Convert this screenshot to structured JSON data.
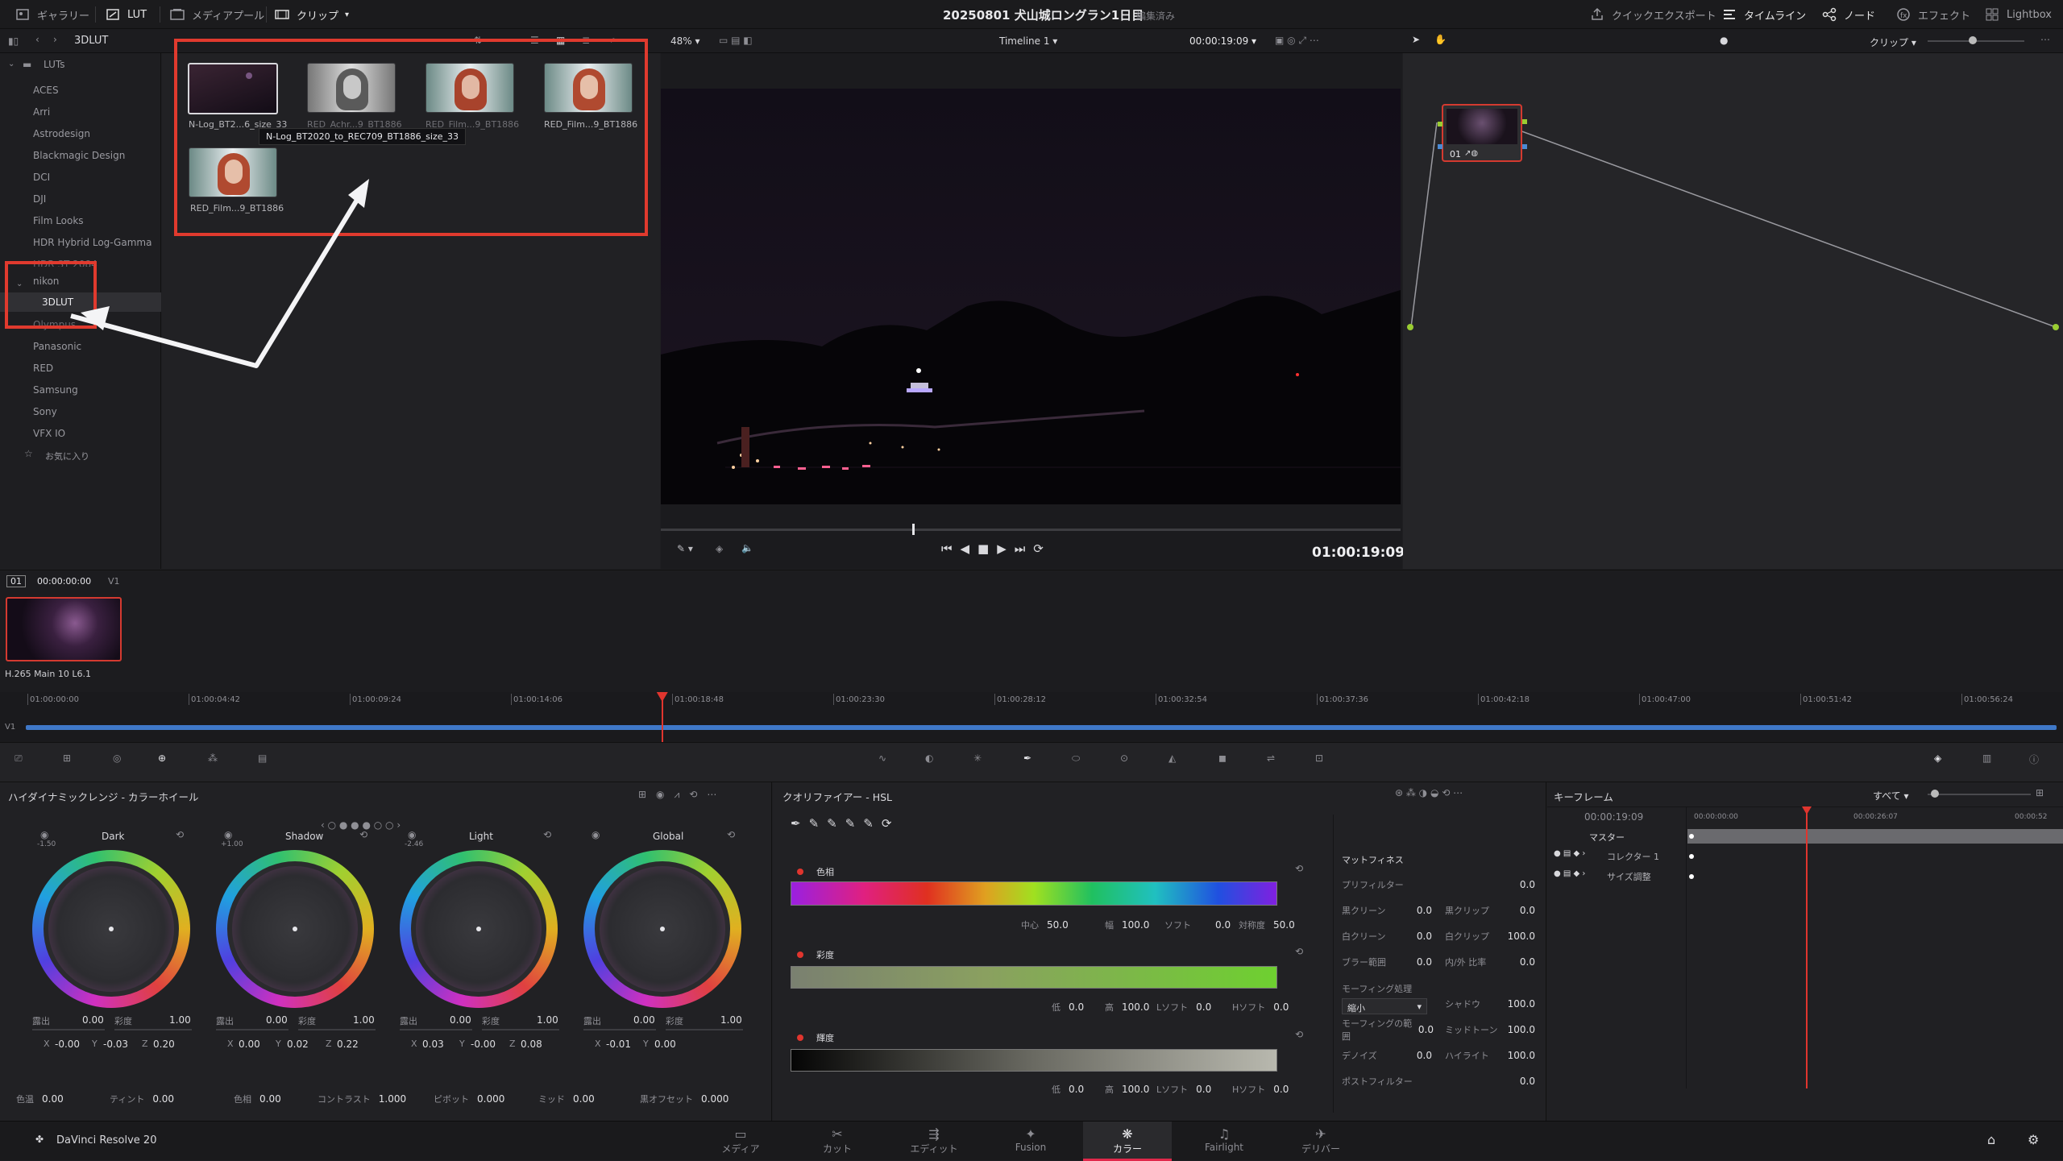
{
  "topbar": {
    "gallery": "ギャラリー",
    "lut": "LUT",
    "media_pool": "メディアプール",
    "clip": "クリップ",
    "project_title": "20250801 犬山城ロングラン1日目",
    "project_status": "編集済み",
    "quick_export": "クイックエクスポート",
    "timeline": "タイムライン",
    "nodes": "ノード",
    "effects": "エフェクト",
    "lightbox": "Lightbox"
  },
  "subbar": {
    "folder": "3DLUT",
    "zoom": "48%",
    "timeline_name": "Timeline 1",
    "timecode": "00:00:19:09",
    "clip_mode": "クリップ"
  },
  "lut_tree": {
    "root": "LUTs",
    "items": [
      "ACES",
      "Arri",
      "Astrodesign",
      "Blackmagic Design",
      "DCI",
      "DJI",
      "Film Looks",
      "HDR Hybrid Log-Gamma",
      "HDR ST 2084"
    ],
    "nikon": "nikon",
    "nikon_child": "3DLUT",
    "items_after": [
      "Olympus",
      "Panasonic",
      "RED",
      "Samsung",
      "Sony",
      "VFX IO"
    ],
    "favorites": "お気に入り"
  },
  "lut_browser": {
    "thumbs": [
      {
        "label": "N-Log_BT2...6_size_33"
      },
      {
        "label": "RED_Achr...9_BT1886"
      },
      {
        "label": "RED_Film...9_BT1886"
      },
      {
        "label": "RED_Film...9_BT1886"
      },
      {
        "label": "RED_Film...9_BT1886"
      }
    ],
    "tooltip": "N-Log_BT2020_to_REC709_BT1886_size_33"
  },
  "viewer": {
    "timecode": "01:00:19:09",
    "scrub_progress": 0.34
  },
  "nodes": {
    "node_label": "01"
  },
  "clipstrip": {
    "clip_number": "01",
    "clip_tc": "00:00:00:00",
    "track": "V1",
    "codec": "H.265 Main 10 L6.1"
  },
  "ruler": {
    "ticks": [
      "01:00:00:00",
      "01:00:04:42",
      "01:00:09:24",
      "01:00:14:06",
      "01:00:18:48",
      "01:00:23:30",
      "01:00:28:12",
      "01:00:32:54",
      "01:00:37:36",
      "01:00:42:18",
      "01:00:47:00",
      "01:00:51:42",
      "01:00:56:24"
    ],
    "track": "V1",
    "playhead_fraction": 0.313
  },
  "wheels": {
    "title": "ハイダイナミックレンジ - カラーホイール",
    "items": [
      {
        "name": "Dark",
        "top": "-1.50",
        "exposure": "0.00",
        "sat": "1.00",
        "x": "-0.00",
        "y": "-0.03",
        "z": "0.20"
      },
      {
        "name": "Shadow",
        "top": "+1.00",
        "exposure": "0.00",
        "sat": "1.00",
        "x": "0.00",
        "y": "0.02",
        "z": "0.22"
      },
      {
        "name": "Light",
        "top": "-2.46",
        "exposure": "0.00",
        "sat": "1.00",
        "x": "0.03",
        "y": "-0.00",
        "z": "0.08"
      },
      {
        "name": "Global",
        "top": "",
        "exposure": "0.00",
        "sat": "1.00",
        "x": "-0.01",
        "y": "0.00",
        "z": ""
      }
    ],
    "exp_label": "露出",
    "sat_label": "彩度",
    "bottom": [
      {
        "label": "色温",
        "value": "0.00"
      },
      {
        "label": "ティント",
        "value": "0.00"
      },
      {
        "label": "色相",
        "value": "0.00"
      },
      {
        "label": "コントラスト",
        "value": "1.000"
      },
      {
        "label": "ピボット",
        "value": "0.000"
      },
      {
        "label": "ミッド",
        "value": "0.00"
      },
      {
        "label": "黒オフセット",
        "value": "0.000"
      }
    ]
  },
  "hsl": {
    "title": "クオリファイアー - HSL",
    "hue": {
      "label": "色相",
      "center_label": "中心",
      "center": "50.0",
      "width_label": "幅",
      "width": "100.0",
      "soft_label": "ソフト",
      "soft": "0.0",
      "sym_label": "対称度",
      "sym": "50.0"
    },
    "sat": {
      "label": "彩度",
      "low_label": "低",
      "low": "0.0",
      "high_label": "高",
      "high": "100.0",
      "lsoft_label": "Lソフト",
      "lsoft": "0.0",
      "hsoft_label": "Hソフト",
      "hsoft": "0.0"
    },
    "lum": {
      "label": "輝度",
      "low_label": "低",
      "low": "0.0",
      "high_label": "高",
      "high": "100.0",
      "lsoft_label": "Lソフト",
      "lsoft": "0.0",
      "hsoft_label": "Hソフト",
      "hsoft": "0.0"
    },
    "matte": {
      "title": "マットフィネス",
      "pre_filter": "プリフィルター",
      "pre_filter_v": "0.0",
      "black_clean": "黒クリーン",
      "black_clean_v": "0.0",
      "black_clip": "黒クリップ",
      "black_clip_v": "0.0",
      "white_clean": "白クリーン",
      "white_clean_v": "0.0",
      "white_clip": "白クリップ",
      "white_clip_v": "100.0",
      "blur": "ブラー範囲",
      "blur_v": "0.0",
      "inout": "内/外 比率",
      "inout_v": "0.0",
      "morph": "モーフィング処理",
      "morph_sel": "縮小",
      "shadow": "シャドウ",
      "shadow_v": "100.0",
      "morph_range": "モーフィングの範囲",
      "morph_range_v": "0.0",
      "midtone": "ミッドトーン",
      "midtone_v": "100.0",
      "denoise": "デノイズ",
      "denoise_v": "0.0",
      "highlight": "ハイライト",
      "highlight_v": "100.0",
      "post_filter": "ポストフィルター",
      "post_filter_v": "0.0"
    }
  },
  "keyframes": {
    "title": "キーフレーム",
    "filter": "すべて",
    "timecode": "00:00:19:09",
    "ruler_start": "00:00:00:00",
    "ruler_mid": "00:00:26:07",
    "ruler_end": "00:00:52",
    "master": "マスター",
    "rows": [
      "コレクター 1",
      "サイズ調整"
    ]
  },
  "pagenav": {
    "app": "DaVinci Resolve 20",
    "tabs": [
      "メディア",
      "カット",
      "エディット",
      "Fusion",
      "カラー",
      "Fairlight",
      "デリバー"
    ],
    "active": "カラー"
  },
  "colors": {
    "accent": "#e03a2e",
    "active_tab": "#e0284a",
    "node_green": "#9acd32"
  }
}
